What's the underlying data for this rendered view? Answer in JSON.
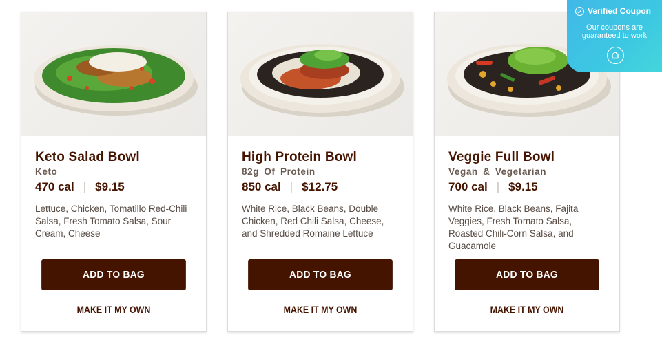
{
  "cards": [
    {
      "name": "Keto Salad Bowl",
      "tag": "Keto",
      "calories": "470 cal",
      "price": "$9.15",
      "description": "Lettuce, Chicken, Tomatillo Red-Chili Salsa, Fresh Tomato Salsa, Sour Cream, Cheese",
      "add_label": "ADD TO BAG",
      "own_label": "MAKE IT MY OWN"
    },
    {
      "name": "High Protein Bowl",
      "tag": "82g Of Protein",
      "calories": "850 cal",
      "price": "$12.75",
      "description": "White Rice, Black Beans, Double Chicken, Red Chili Salsa, Cheese, and Shredded Romaine Lettuce",
      "add_label": "ADD TO BAG",
      "own_label": "MAKE IT MY OWN"
    },
    {
      "name": "Veggie Full Bowl",
      "tag": "Vegan & Vegetarian",
      "calories": "700 cal",
      "price": "$9.15",
      "description": "White Rice, Black Beans, Fajita Veggies, Fresh Tomato Salsa, Roasted Chili-Corn Salsa, and Guacamole",
      "add_label": "ADD TO BAG",
      "own_label": "MAKE IT MY OWN"
    }
  ],
  "coupon": {
    "title": "Verified Coupon",
    "subtitle": "Our coupons are guaranteed to work"
  },
  "colors": {
    "brand": "#451400",
    "coupon_accent": "#3cc8e2"
  },
  "icons": {
    "verified": "check-circle-icon",
    "coupon_logo": "coupon-logo-icon"
  }
}
